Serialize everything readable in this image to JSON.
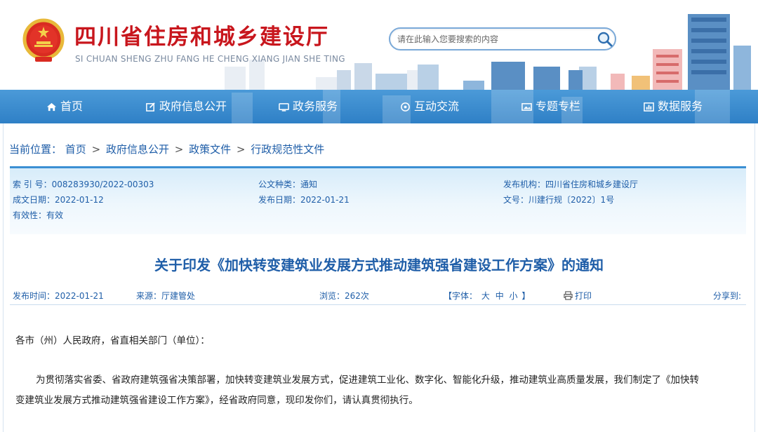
{
  "header": {
    "title_cn": "四川省住房和城乡建设厅",
    "title_en": "SI CHUAN SHENG ZHU FANG HE CHENG XIANG JIAN SHE TING",
    "search_placeholder": "请在此输入您要搜索的内容",
    "emblem_icon": "national-emblem-icon",
    "search_icon": "magnifier-icon"
  },
  "nav": [
    {
      "label": "首页",
      "icon": "home-icon"
    },
    {
      "label": "政府信息公开",
      "icon": "edit-icon"
    },
    {
      "label": "政务服务",
      "icon": "monitor-icon"
    },
    {
      "label": "互动交流",
      "icon": "interaction-icon"
    },
    {
      "label": "专题专栏",
      "icon": "image-icon"
    },
    {
      "label": "数据服务",
      "icon": "chart-icon"
    }
  ],
  "breadcrumb": {
    "prefix": "当前位置：",
    "items": [
      "首页",
      "政府信息公开",
      "政策文件",
      "行政规范性文件"
    ],
    "separator": ">"
  },
  "meta": {
    "index_label": "索 引 号：",
    "index_value": "008283930/2022-00303",
    "type_label": "公文种类：",
    "type_value": "通知",
    "org_label": "发布机构：",
    "org_value": "四川省住房和城乡建设厅",
    "created_label": "成文日期：",
    "created_value": "2022-01-12",
    "published_label": "发布日期：",
    "published_value": "2022-01-21",
    "docno_label": "文号：",
    "docno_value": "川建行规〔2022〕1号",
    "validity_label": "有效性：",
    "validity_value": "有效"
  },
  "document": {
    "title": "关于印发《加快转变建筑业发展方式推动建筑强省建设工作方案》的通知",
    "pub_time_label": "发布时间：",
    "pub_time_value": "2022-01-21",
    "source_label": "来源：",
    "source_value": "厅建管处",
    "views_label": "浏览：",
    "views_value": "262次",
    "font_label": "【字体：",
    "font_large": "大",
    "font_medium": "中",
    "font_small": "小",
    "font_close": "】",
    "print_label": "打印",
    "share_label": "分享到:",
    "salutation": "各市（州）人民政府，省直相关部门（单位）：",
    "paragraph_line1": "为贯彻落实省委、省政府建筑强省决策部署，加快转变建筑业发展方式，促进建筑工业化、数字化、智能化升级，推动建筑业高质量发展，我们制定了《加快转",
    "paragraph_line2": "变建筑业发展方式推动建筑强省建设工作方案》，经省政府同意，现印发你们，请认真贯彻执行。"
  },
  "colors": {
    "brand_red": "#c8161d",
    "nav_blue": "#3b8fd3",
    "link_blue": "#1f5ea8",
    "meta_bg": "#d7ecfa"
  }
}
